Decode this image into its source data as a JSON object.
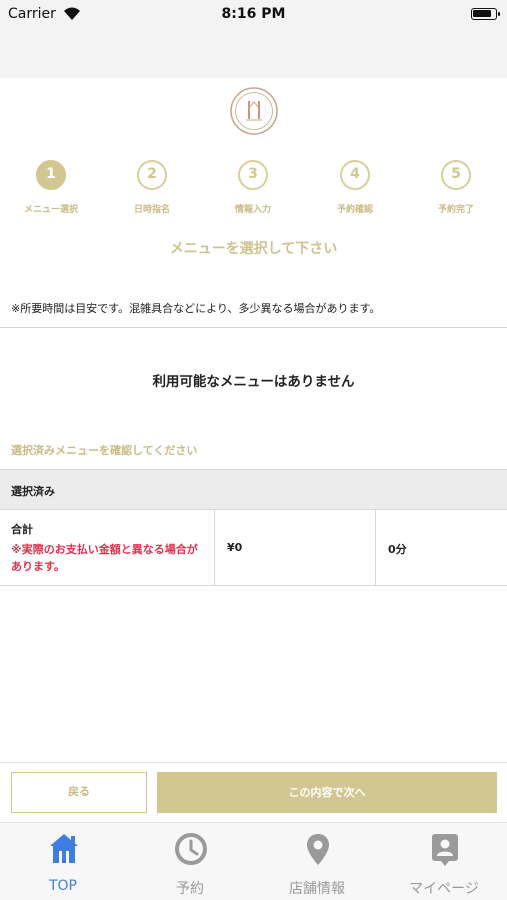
{
  "status_bar": {
    "carrier": "Carrier",
    "time": "8:16 PM"
  },
  "steps": [
    {
      "number": "1",
      "label": "メニュー選択",
      "active": true
    },
    {
      "number": "2",
      "label": "日時指名",
      "active": false
    },
    {
      "number": "3",
      "label": "情報入力",
      "active": false
    },
    {
      "number": "4",
      "label": "予約確認",
      "active": false
    },
    {
      "number": "5",
      "label": "予約完了",
      "active": false
    }
  ],
  "main": {
    "prompt": "メニューを選択して下さい",
    "note": "※所要時間は目安です。混雑具合などにより、多少異なる場合があります。",
    "empty_message": "利用可能なメニューはありません",
    "confirm_heading": "選択済みメニューを確認してください",
    "selected_header": "選択済み",
    "summary": {
      "label": "合計",
      "warning": "※実際のお支払い金額と異なる場合があります。",
      "price": "¥0",
      "duration": "0分"
    }
  },
  "actions": {
    "back_label": "戻る",
    "next_label": "この内容で次へ"
  },
  "tabbar": [
    {
      "label": "TOP",
      "icon": "home-icon",
      "active": true
    },
    {
      "label": "予約",
      "icon": "clock-icon",
      "active": false
    },
    {
      "label": "店舗情報",
      "icon": "location-pin-icon",
      "active": false
    },
    {
      "label": "マイページ",
      "icon": "user-badge-icon",
      "active": false
    }
  ],
  "colors": {
    "gold": "#d2c691",
    "warning": "#e2314d",
    "active_tab": "#3f7ee0",
    "inactive_tab": "#9a9a9a"
  }
}
